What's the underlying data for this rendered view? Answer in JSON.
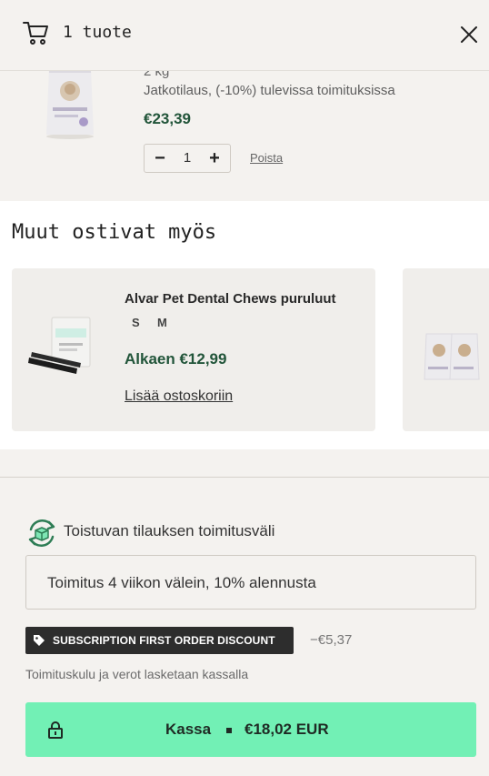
{
  "header": {
    "title": "1 tuote",
    "cart_icon": "cart-icon",
    "close_icon": "close-icon"
  },
  "cart_item": {
    "variant_partial": "2 kg",
    "subscription_note": "Jatkotilaus, (-10%) tulevissa toimituksissa",
    "price": "€23,39",
    "quantity": "1",
    "minus_label": "−",
    "plus_label": "+",
    "remove_label": "Poista"
  },
  "upsell": {
    "title": "Muut ostivat myös",
    "products": [
      {
        "name": "Alvar Pet Dental Chews puruluut",
        "variants": [
          "S",
          "M"
        ],
        "price": "Alkaen €12,99",
        "add_label": "Lisää ostoskoriin"
      }
    ]
  },
  "subscription": {
    "label": "Toistuvan tilauksen toimitusväli",
    "selected_option": "Toimitus 4 viikon välein, 10% alennusta"
  },
  "discount": {
    "label": "SUBSCRIPTION FIRST ORDER DISCOUNT",
    "amount": "−€5,37"
  },
  "shipping_note": "Toimituskulu ja verot lasketaan kassalla",
  "checkout": {
    "label": "Kassa",
    "total": "€18,02 EUR"
  },
  "colors": {
    "accent_green": "#72f0b5",
    "price_green": "#22553a",
    "background": "#f4f2ef",
    "badge": "#2d2d2d"
  }
}
